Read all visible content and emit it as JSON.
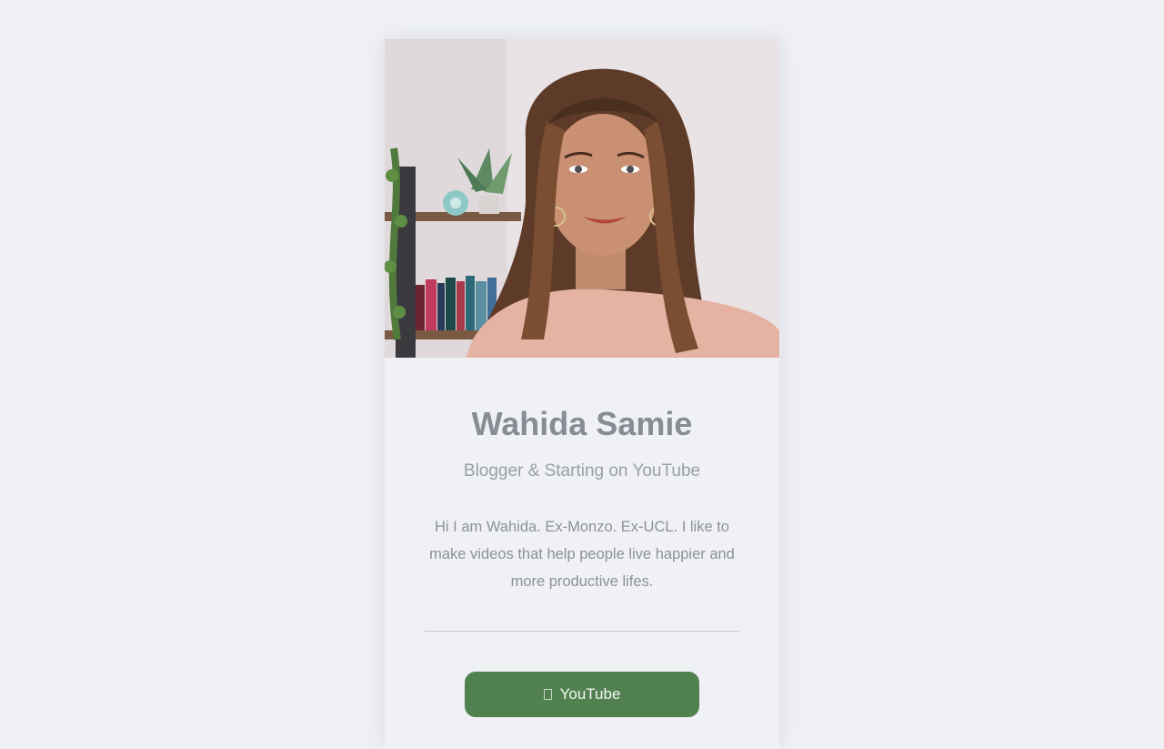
{
  "profile": {
    "name": "Wahida Samie",
    "tagline": "Blogger & Starting on YouTube",
    "bio": "Hi I am Wahida. Ex-Monzo. Ex-UCL. I like to make videos that help people live happier and more productive lifes."
  },
  "links": [
    {
      "label": "YouTube",
      "icon": "youtube-icon"
    }
  ],
  "colors": {
    "background": "#eff1f5",
    "button": "#528150",
    "name": "#878c95",
    "text": "#8d9198"
  }
}
